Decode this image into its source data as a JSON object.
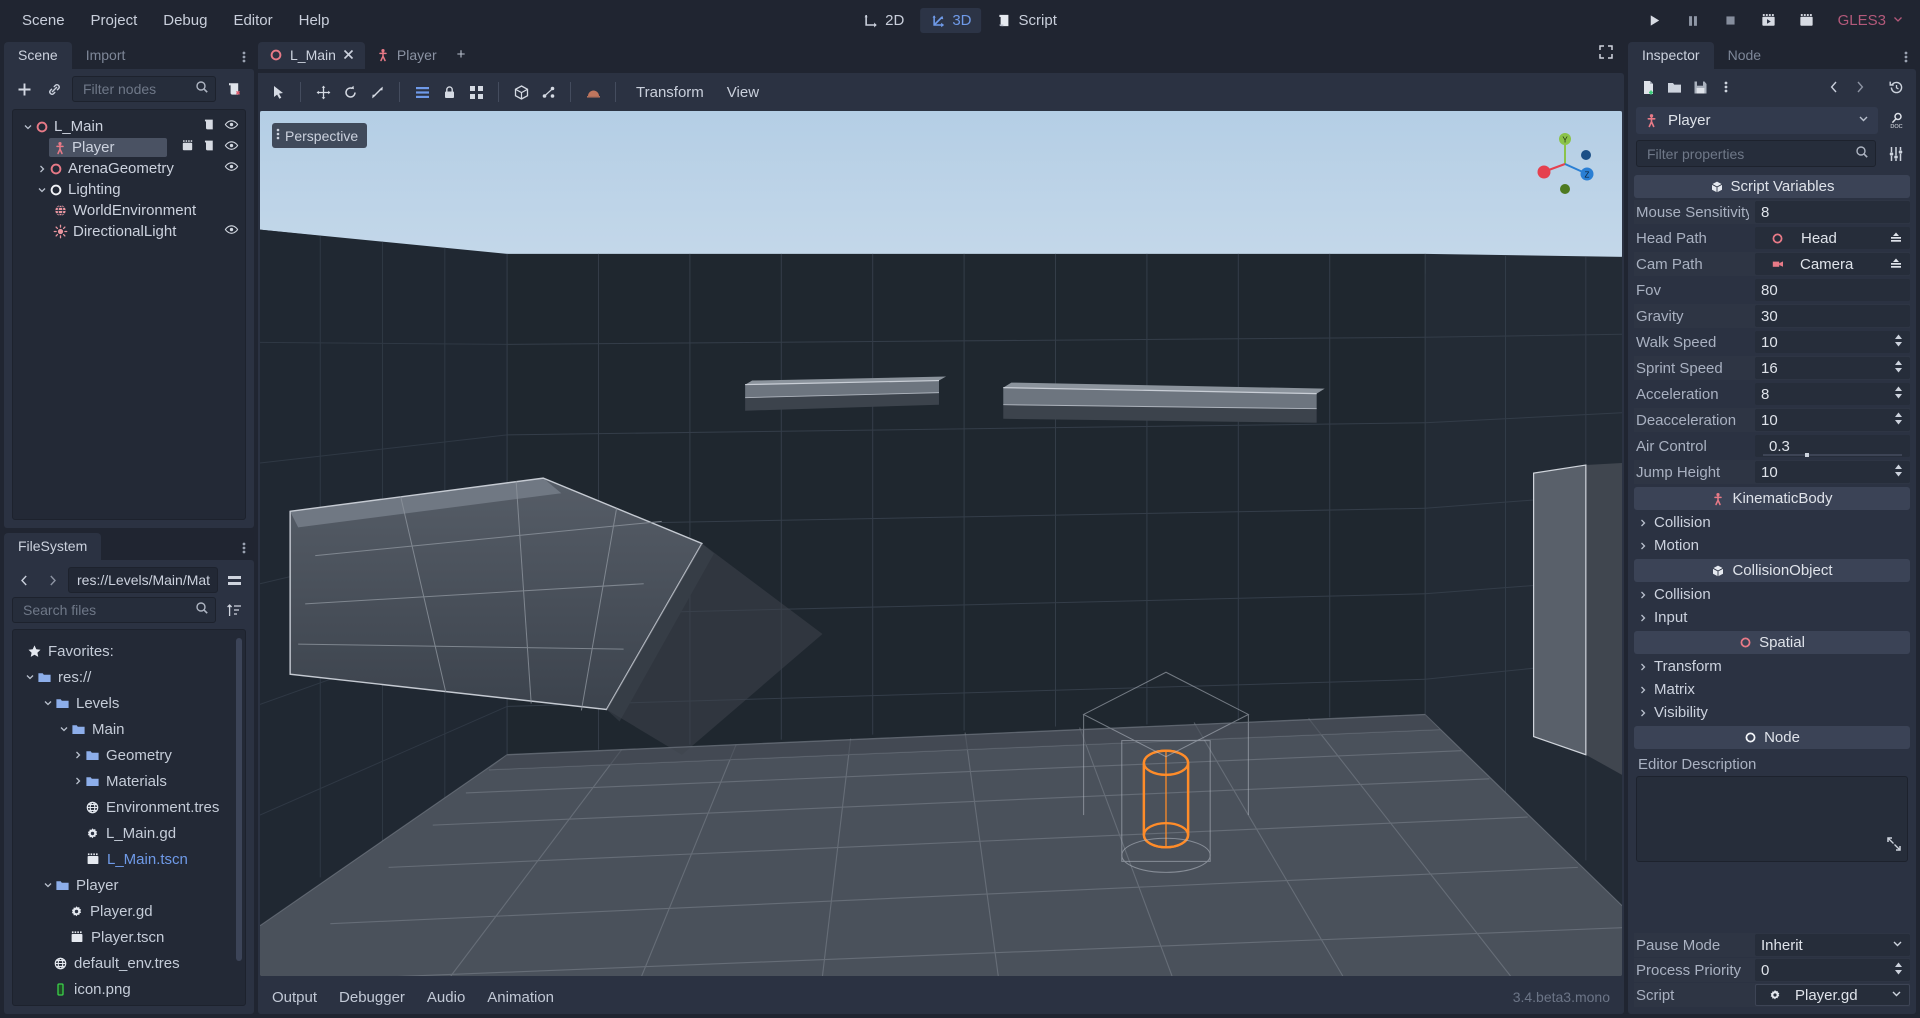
{
  "menu": {
    "items": [
      "Scene",
      "Project",
      "Debug",
      "Editor",
      "Help"
    ]
  },
  "main_modes": [
    {
      "label": "2D",
      "icon": "axis-2d-icon",
      "active": false
    },
    {
      "label": "3D",
      "icon": "axis-3d-icon",
      "active": true
    },
    {
      "label": "Script",
      "icon": "script-icon",
      "active": false
    }
  ],
  "playbar": {
    "buttons": [
      "play-icon",
      "pause-icon",
      "stop-icon",
      "play-scene-icon",
      "play-custom-scene-icon"
    ],
    "renderer": "GLES3"
  },
  "scene_dock": {
    "tabs": [
      {
        "label": "Scene",
        "active": true
      },
      {
        "label": "Import",
        "active": false
      }
    ],
    "toolbar": {
      "add_node": "add-node-icon",
      "instance": "link-icon",
      "filter_placeholder": "Filter nodes",
      "filter_value": "",
      "search_icon": "search-icon",
      "tree_options": "create-script-icon"
    },
    "tree": [
      {
        "name": "L_Main",
        "icon": "spatial-icon",
        "depth": 0,
        "expand": "open",
        "selected": false,
        "script": true,
        "visibility": true
      },
      {
        "name": "Player",
        "icon": "kinematicbody-icon",
        "depth": 1,
        "expand": "none",
        "selected": true,
        "script": true,
        "visibility": true,
        "signal": true
      },
      {
        "name": "ArenaGeometry",
        "icon": "spatial-icon",
        "depth": 1,
        "expand": "closed",
        "selected": false,
        "script": false,
        "visibility": true
      },
      {
        "name": "Lighting",
        "icon": "node-icon",
        "depth": 1,
        "expand": "open",
        "selected": false,
        "script": false,
        "visibility": false
      },
      {
        "name": "WorldEnvironment",
        "icon": "world-environment-icon",
        "depth": 2,
        "expand": "none",
        "selected": false,
        "script": false,
        "visibility": false
      },
      {
        "name": "DirectionalLight",
        "icon": "directional-light-icon",
        "depth": 2,
        "expand": "none",
        "selected": false,
        "script": false,
        "visibility": true
      }
    ]
  },
  "filesystem_dock": {
    "tab": "FileSystem",
    "path": "res://Levels/Main/Mat",
    "search_placeholder": "Search files",
    "search_value": "",
    "tree": [
      {
        "name": "Favorites:",
        "icon": "star-icon",
        "depth": 0,
        "expand": "none",
        "kind": "favorites"
      },
      {
        "name": "res://",
        "icon": "folder-icon",
        "depth": 0,
        "expand": "open",
        "kind": "folder"
      },
      {
        "name": "Levels",
        "icon": "folder-icon",
        "depth": 1,
        "expand": "open",
        "kind": "folder"
      },
      {
        "name": "Main",
        "icon": "folder-icon",
        "depth": 2,
        "expand": "open",
        "kind": "folder"
      },
      {
        "name": "Geometry",
        "icon": "folder-icon",
        "depth": 3,
        "expand": "closed",
        "kind": "folder"
      },
      {
        "name": "Materials",
        "icon": "folder-icon",
        "depth": 3,
        "expand": "closed",
        "kind": "folder"
      },
      {
        "name": "Environment.tres",
        "icon": "resource-icon",
        "depth": 3,
        "expand": "none",
        "kind": "file"
      },
      {
        "name": "L_Main.gd",
        "icon": "gdscript-icon",
        "depth": 3,
        "expand": "none",
        "kind": "file"
      },
      {
        "name": "L_Main.tscn",
        "icon": "packedscene-icon",
        "depth": 3,
        "expand": "none",
        "kind": "file",
        "highlight": true
      },
      {
        "name": "Player",
        "icon": "folder-icon",
        "depth": 1,
        "expand": "open",
        "kind": "folder"
      },
      {
        "name": "Player.gd",
        "icon": "gdscript-icon",
        "depth": 2,
        "expand": "none",
        "kind": "file"
      },
      {
        "name": "Player.tscn",
        "icon": "packedscene-icon",
        "depth": 2,
        "expand": "none",
        "kind": "file"
      },
      {
        "name": "default_env.tres",
        "icon": "resource-icon",
        "depth": 1,
        "expand": "none",
        "kind": "file"
      },
      {
        "name": "icon.png",
        "icon": "image-icon",
        "depth": 1,
        "expand": "none",
        "kind": "file"
      }
    ]
  },
  "viewport": {
    "tabs": [
      {
        "label": "L_Main",
        "icon": "spatial-icon",
        "active": true,
        "closable": true
      },
      {
        "label": "Player",
        "icon": "kinematicbody-icon",
        "active": false,
        "closable": false
      }
    ],
    "add_tab": "+",
    "toolbar": {
      "tools": [
        "select-icon",
        "move-icon",
        "rotate-icon",
        "scale-icon",
        "list-select-icon",
        "lock-icon",
        "group-icon",
        "snap-icon",
        "room-icon",
        "light-icon"
      ],
      "menus": [
        "Transform",
        "View"
      ]
    },
    "perspective_label": "Perspective",
    "gizmo_axes": [
      "y",
      "x",
      "z"
    ]
  },
  "bottom_panel": {
    "items": [
      "Output",
      "Debugger",
      "Audio",
      "Animation"
    ],
    "version": "3.4.beta3.mono"
  },
  "inspector": {
    "tabs": [
      {
        "label": "Inspector",
        "active": true
      },
      {
        "label": "Node",
        "active": false
      }
    ],
    "toolbar": {
      "new_resource": "new-resource-icon",
      "load": "folder-open-icon",
      "save": "save-icon",
      "tools": "vertical-dots-icon",
      "back": "chevron-left-icon",
      "forward": "chevron-right-icon",
      "history": "history-icon"
    },
    "selected_node": "Player",
    "help_icon": "doc-icon",
    "filter_placeholder": "Filter properties",
    "filter_value": "",
    "object_tools_icon": "object-tools-icon",
    "sections": [
      {
        "type": "category",
        "label": "Script Variables",
        "icon": "object-icon"
      },
      {
        "type": "prop",
        "name": "Mouse Sensitivity",
        "value": "8",
        "control": "text"
      },
      {
        "type": "prop",
        "name": "Head Path",
        "value": "Head",
        "control": "nodepath",
        "icon": "spatial-icon"
      },
      {
        "type": "prop",
        "name": "Cam Path",
        "value": "Camera",
        "control": "nodepath",
        "icon": "camera-icon"
      },
      {
        "type": "prop",
        "name": "Fov",
        "value": "80",
        "control": "text"
      },
      {
        "type": "prop",
        "name": "Gravity",
        "value": "30",
        "control": "text"
      },
      {
        "type": "prop",
        "name": "Walk Speed",
        "value": "10",
        "control": "spin"
      },
      {
        "type": "prop",
        "name": "Sprint Speed",
        "value": "16",
        "control": "spin"
      },
      {
        "type": "prop",
        "name": "Acceleration",
        "value": "8",
        "control": "spin"
      },
      {
        "type": "prop",
        "name": "Deacceleration",
        "value": "10",
        "control": "spin"
      },
      {
        "type": "prop",
        "name": "Air Control",
        "value": "0.3",
        "control": "slider"
      },
      {
        "type": "prop",
        "name": "Jump Height",
        "value": "10",
        "control": "spin"
      },
      {
        "type": "category",
        "label": "KinematicBody",
        "icon": "kinematicbody-icon"
      },
      {
        "type": "sub",
        "label": "Collision"
      },
      {
        "type": "sub",
        "label": "Motion"
      },
      {
        "type": "category",
        "label": "CollisionObject",
        "icon": "object-icon"
      },
      {
        "type": "sub",
        "label": "Collision"
      },
      {
        "type": "sub",
        "label": "Input"
      },
      {
        "type": "category",
        "label": "Spatial",
        "icon": "spatial-icon"
      },
      {
        "type": "sub",
        "label": "Transform"
      },
      {
        "type": "sub",
        "label": "Matrix"
      },
      {
        "type": "sub",
        "label": "Visibility"
      },
      {
        "type": "category",
        "label": "Node",
        "icon": "node-icon"
      }
    ],
    "editor_description_label": "Editor Description",
    "editor_description_value": "",
    "bottom_props": [
      {
        "name": "Pause Mode",
        "value": "Inherit",
        "control": "dropdown"
      },
      {
        "name": "Process Priority",
        "value": "0",
        "control": "spin"
      },
      {
        "name": "Script",
        "value": "Player.gd",
        "control": "resource",
        "icon": "gdscript-icon"
      }
    ]
  },
  "colors": {
    "bg_dark": "#202531",
    "panel": "#2b3242",
    "panel_dark": "#232936",
    "accent_blue": "#6f9ae8",
    "accent_red": "#e87a87",
    "text": "#ccd2de",
    "text_dim": "#8b93a3",
    "gles_pink": "#b3597a",
    "selection": "#4a5263",
    "gizmo_x": "#fc4martin",
    "sky": "#c3d7e9",
    "wall": "#1a2029",
    "selected_mesh_orange": "#ff8c29"
  }
}
